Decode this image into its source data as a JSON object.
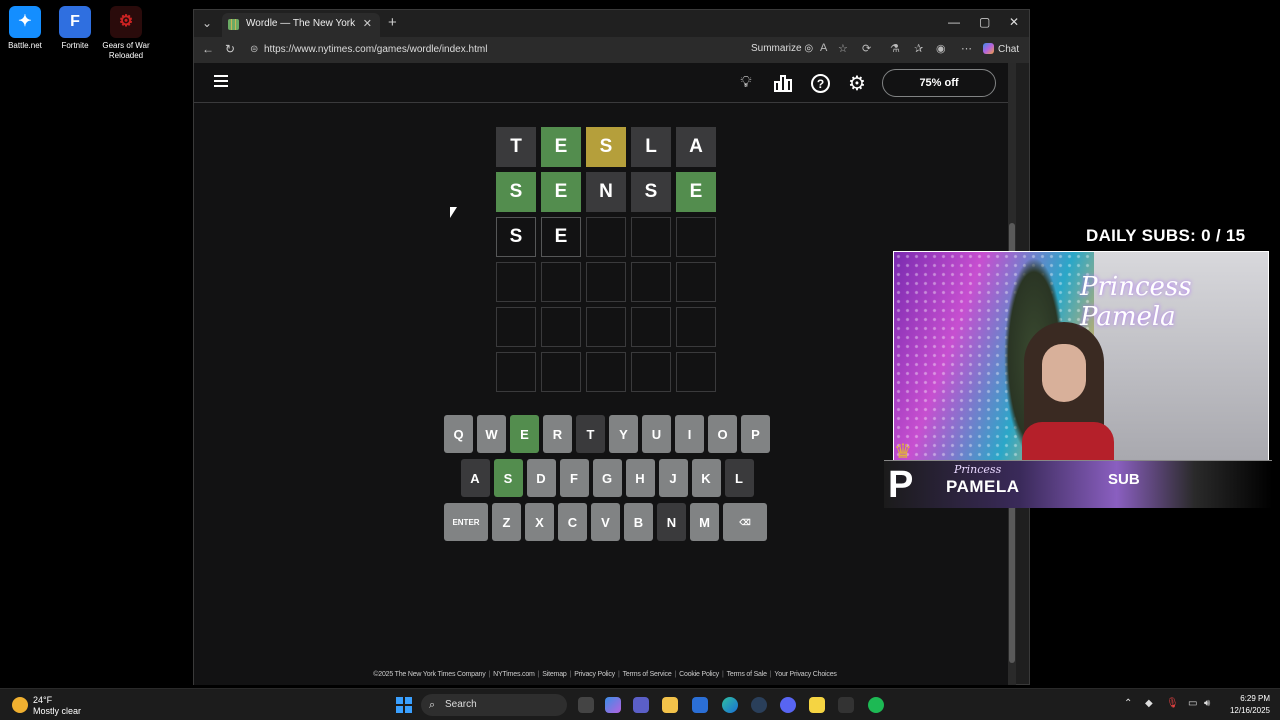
{
  "desktop": {
    "icons": [
      {
        "label": "Battle.net"
      },
      {
        "label": "Fortnite"
      },
      {
        "label": "Gears of War Reloaded"
      }
    ]
  },
  "browser": {
    "tab_title": "Wordle — The New York Times",
    "url": "https://www.nytimes.com/games/wordle/index.html",
    "summarize_label": "Summarize",
    "chat_label": "Chat"
  },
  "wordle": {
    "subscribe_label": "75% off",
    "rows": [
      [
        {
          "l": "T",
          "s": "absent"
        },
        {
          "l": "E",
          "s": "correct"
        },
        {
          "l": "S",
          "s": "present"
        },
        {
          "l": "L",
          "s": "absent"
        },
        {
          "l": "A",
          "s": "absent"
        }
      ],
      [
        {
          "l": "S",
          "s": "correct"
        },
        {
          "l": "E",
          "s": "correct"
        },
        {
          "l": "N",
          "s": "absent"
        },
        {
          "l": "S",
          "s": "absent"
        },
        {
          "l": "E",
          "s": "correct"
        }
      ],
      [
        {
          "l": "S",
          "s": "filled"
        },
        {
          "l": "E",
          "s": "filled"
        },
        {
          "l": "",
          "s": "empty"
        },
        {
          "l": "",
          "s": "empty"
        },
        {
          "l": "",
          "s": "empty"
        }
      ],
      [
        {
          "l": "",
          "s": "empty"
        },
        {
          "l": "",
          "s": "empty"
        },
        {
          "l": "",
          "s": "empty"
        },
        {
          "l": "",
          "s": "empty"
        },
        {
          "l": "",
          "s": "empty"
        }
      ],
      [
        {
          "l": "",
          "s": "empty"
        },
        {
          "l": "",
          "s": "empty"
        },
        {
          "l": "",
          "s": "empty"
        },
        {
          "l": "",
          "s": "empty"
        },
        {
          "l": "",
          "s": "empty"
        }
      ],
      [
        {
          "l": "",
          "s": "empty"
        },
        {
          "l": "",
          "s": "empty"
        },
        {
          "l": "",
          "s": "empty"
        },
        {
          "l": "",
          "s": "empty"
        },
        {
          "l": "",
          "s": "empty"
        }
      ]
    ],
    "keyboard": [
      [
        {
          "k": "Q"
        },
        {
          "k": "W"
        },
        {
          "k": "E",
          "s": "correct"
        },
        {
          "k": "R"
        },
        {
          "k": "T",
          "s": "absent"
        },
        {
          "k": "Y"
        },
        {
          "k": "U"
        },
        {
          "k": "I"
        },
        {
          "k": "O"
        },
        {
          "k": "P"
        }
      ],
      [
        {
          "k": "A",
          "s": "absent"
        },
        {
          "k": "S",
          "s": "correct"
        },
        {
          "k": "D"
        },
        {
          "k": "F"
        },
        {
          "k": "G"
        },
        {
          "k": "H"
        },
        {
          "k": "J"
        },
        {
          "k": "K"
        },
        {
          "k": "L",
          "s": "absent"
        }
      ],
      [
        {
          "k": "ENTER",
          "wide": true
        },
        {
          "k": "Z"
        },
        {
          "k": "X"
        },
        {
          "k": "C"
        },
        {
          "k": "V"
        },
        {
          "k": "B"
        },
        {
          "k": "N",
          "s": "absent"
        },
        {
          "k": "M"
        },
        {
          "k": "⌫",
          "wide": true
        }
      ]
    ],
    "footer_links": [
      "©2025 The New York Times Company",
      "NYTimes.com",
      "Sitemap",
      "Privacy Policy",
      "Terms of Service",
      "Cookie Policy",
      "Terms of Sale",
      "Your Privacy Choices"
    ]
  },
  "overlay": {
    "daily_subs": "DAILY SUBS:  0 / 15",
    "signature": "Princess Pamela",
    "banner_small": "Princess",
    "banner_name": "PAMELA",
    "banner_sub": "SUB"
  },
  "taskbar": {
    "temperature": "24°F",
    "weather": "Mostly clear",
    "search_placeholder": "Search",
    "time": "6:29 PM",
    "date": "12/16/2025"
  },
  "colors": {
    "correct": "#538d4e",
    "present": "#b59f3b",
    "absent": "#3a3a3c",
    "key": "#818384",
    "background": "#121213"
  }
}
